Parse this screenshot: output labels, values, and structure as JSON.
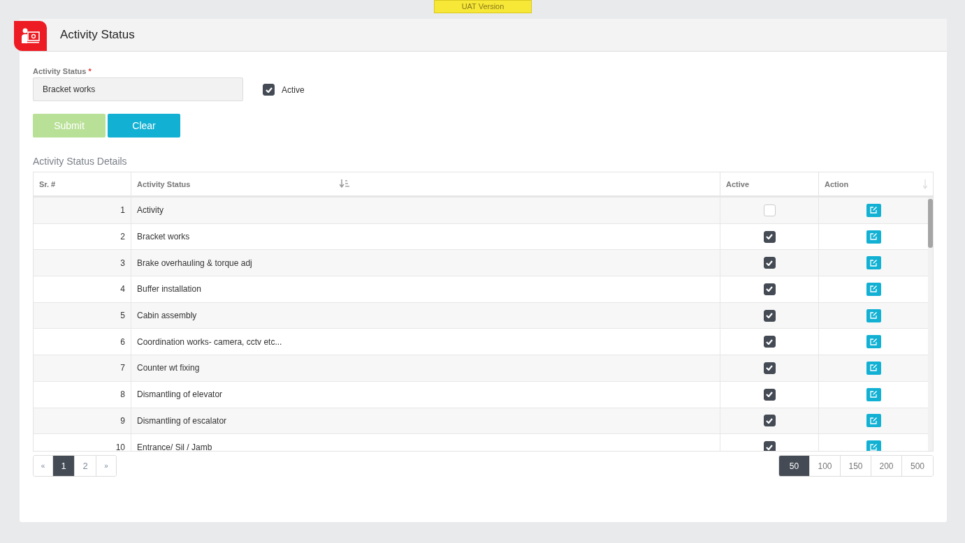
{
  "env_badge": "UAT Version",
  "page": {
    "title": "Activity Status"
  },
  "form": {
    "field_label": "Activity Status",
    "required_mark": "*",
    "field_value": "Bracket works",
    "active_label": "Active",
    "active_checked": true,
    "buttons": [
      {
        "label": "Submit",
        "kind": "submit",
        "disabled": true
      },
      {
        "label": "Clear",
        "kind": "clear",
        "disabled": false
      }
    ]
  },
  "table": {
    "title": "Activity Status Details",
    "columns": [
      "Sr. #",
      "Activity Status",
      "Active",
      "Action"
    ],
    "rows": [
      {
        "no": "1",
        "name": "Activity",
        "active": false
      },
      {
        "no": "2",
        "name": "Bracket works",
        "active": true
      },
      {
        "no": "3",
        "name": "Brake overhauling & torque adj",
        "active": true
      },
      {
        "no": "4",
        "name": "Buffer installation",
        "active": true
      },
      {
        "no": "5",
        "name": "Cabin assembly",
        "active": true
      },
      {
        "no": "6",
        "name": "Coordination works- camera, cctv etc...",
        "active": true
      },
      {
        "no": "7",
        "name": "Counter wt fixing",
        "active": true
      },
      {
        "no": "8",
        "name": "Dismantling of elevator",
        "active": true
      },
      {
        "no": "9",
        "name": "Dismantling of escalator",
        "active": true
      },
      {
        "no": "10",
        "name": "Entrance/ Sil / Jamb",
        "active": true
      }
    ]
  },
  "pagination": {
    "prev": "«",
    "next": "»",
    "pages": [
      {
        "label": "1",
        "selected": true
      },
      {
        "label": "2",
        "selected": false
      }
    ]
  },
  "page_sizes": [
    {
      "label": "50",
      "selected": true
    },
    {
      "label": "100",
      "selected": false
    },
    {
      "label": "150",
      "selected": false
    },
    {
      "label": "200",
      "selected": false
    },
    {
      "label": "500",
      "selected": false
    }
  ]
}
